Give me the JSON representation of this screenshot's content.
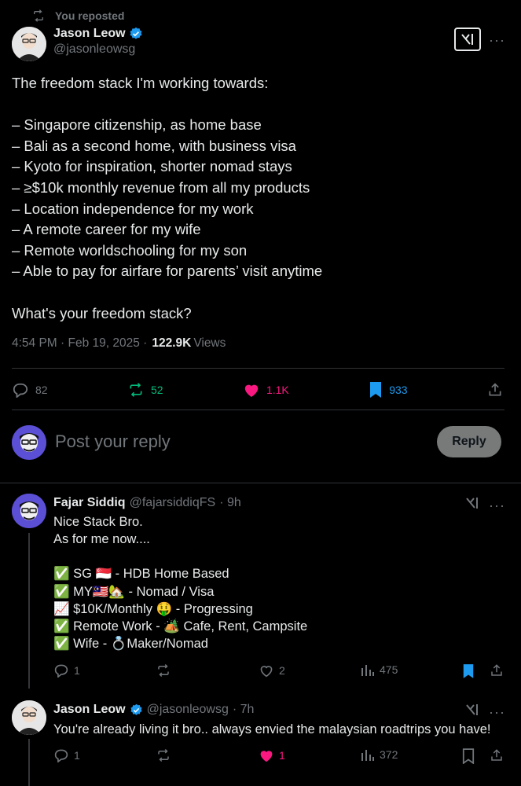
{
  "repost": {
    "label": "You reposted"
  },
  "main_tweet": {
    "author_name": "Jason Leow",
    "author_handle": "@jasonleowsg",
    "text": "The freedom stack I'm working towards:\n\n– Singapore citizenship, as home base\n– Bali as a second home, with business visa\n– Kyoto for inspiration, shorter nomad stays\n– ≥$10k monthly revenue from all my products\n– Location independence for my work\n– A remote career for my wife\n– Remote worldschooling for my son\n– Able to pay for airfare for parents’ visit anytime\n\nWhat's your freedom stack?",
    "time": "4:54 PM · Feb 19, 2025 ·",
    "views_count": "122.9K",
    "views_label": "Views",
    "replies": "82",
    "reposts": "52",
    "likes": "1.1K",
    "bookmarks": "933",
    "more": "···"
  },
  "composer": {
    "placeholder": "Post your reply",
    "button_label": "Reply"
  },
  "replies": [
    {
      "author_name": "Fajar Siddiq",
      "author_handle": "@fajarsiddiqFS",
      "time": "· 9h",
      "lines": [
        "Nice Stack Bro.",
        "As for me now....",
        "",
        "✅ SG 🇸🇬 - HDB Home Based",
        "✅ MY🇲🇾🏡 - Nomad / Visa",
        "📈 $10K/Monthly 🤑 - Progressing",
        "✅ Remote Work - 🏕️ Cafe, Rent, Campsite",
        "✅ Wife - 💍Maker/Nomad"
      ],
      "replies": "1",
      "reposts": "",
      "likes": "2",
      "views": "475",
      "more": "···"
    },
    {
      "author_name": "Jason Leow",
      "author_handle": "@jasonleowsg",
      "time": "· 7h",
      "text": "You're already living it bro.. always envied the malaysian roadtrips you have!",
      "replies": "1",
      "reposts": "",
      "likes": "1",
      "views": "372",
      "more": "···"
    }
  ],
  "colors": {
    "background": "#000000",
    "text": "#e7e9ea",
    "muted": "#71767b",
    "verified": "#1d9bf0",
    "repost_green": "#00ba7c",
    "like_pink": "#f91880",
    "bookmark_blue": "#1d9bf0"
  }
}
